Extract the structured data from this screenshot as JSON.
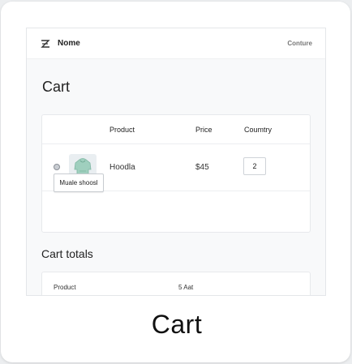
{
  "header": {
    "brand": "Nome",
    "nav_link": "Conture"
  },
  "page": {
    "title": "Cart"
  },
  "table": {
    "columns": [
      "Product",
      "Price",
      "Coumtry"
    ],
    "rows": [
      {
        "name": "Hoodla",
        "price": "$45",
        "quantity": "2",
        "thumbnail_icon": "hoodie-icon"
      }
    ],
    "update_button": "Muale shoosl"
  },
  "totals": {
    "title": "Cart totals",
    "label": "Product",
    "value": "5 Aat"
  },
  "caption": "Cart",
  "colors": {
    "hoodie": "#9fcfbe",
    "background": "#eceef0",
    "card": "#ffffff"
  }
}
